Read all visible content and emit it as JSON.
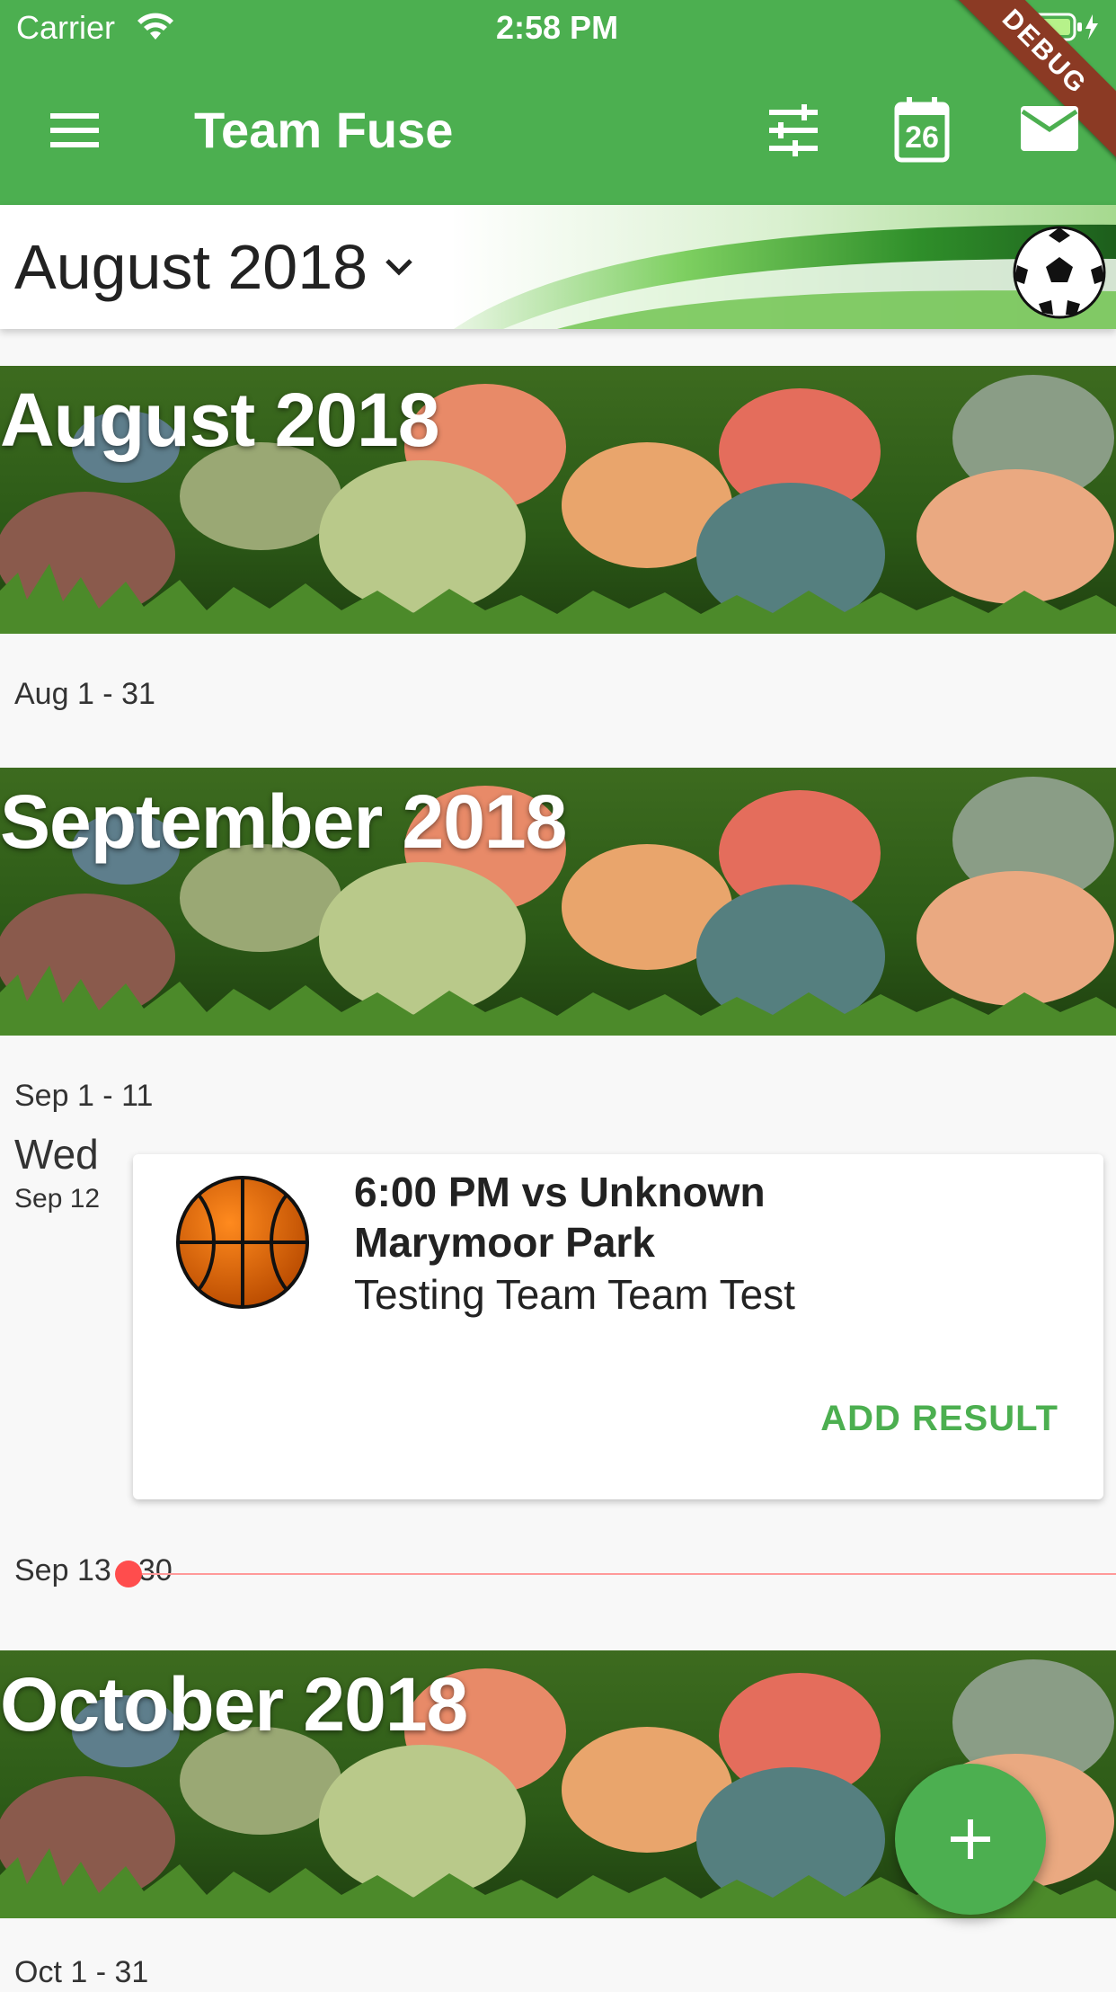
{
  "status_bar": {
    "carrier": "Carrier",
    "time": "2:58 PM"
  },
  "debug_ribbon": "DEBUG",
  "app_bar": {
    "title": "Team Fuse",
    "calendar_icon_day": "26",
    "icons": [
      "menu-icon",
      "filter-sliders-icon",
      "calendar-icon",
      "mail-icon"
    ]
  },
  "header": {
    "selected_month": "August 2018"
  },
  "months": [
    {
      "title": "August 2018",
      "range": "Aug 1 - 31"
    },
    {
      "title": "September 2018",
      "range_before": "Sep 1 - 11",
      "range_after": "Sep 13 - 30"
    },
    {
      "title": "October 2018",
      "range": "Oct 1 - 31"
    }
  ],
  "event": {
    "day_name": "Wed",
    "date": "Sep 12",
    "title_line": "6:00 PM vs Unknown",
    "location": "Marymoor Park",
    "teams": "Testing Team Team Test",
    "action_label": "ADD RESULT",
    "sport_icon": "basketball-icon"
  },
  "colors": {
    "primary": "#4caf50",
    "accent_text": "#4caf50",
    "now_indicator": "#ff4d4d",
    "debug": "#8b3a24"
  }
}
